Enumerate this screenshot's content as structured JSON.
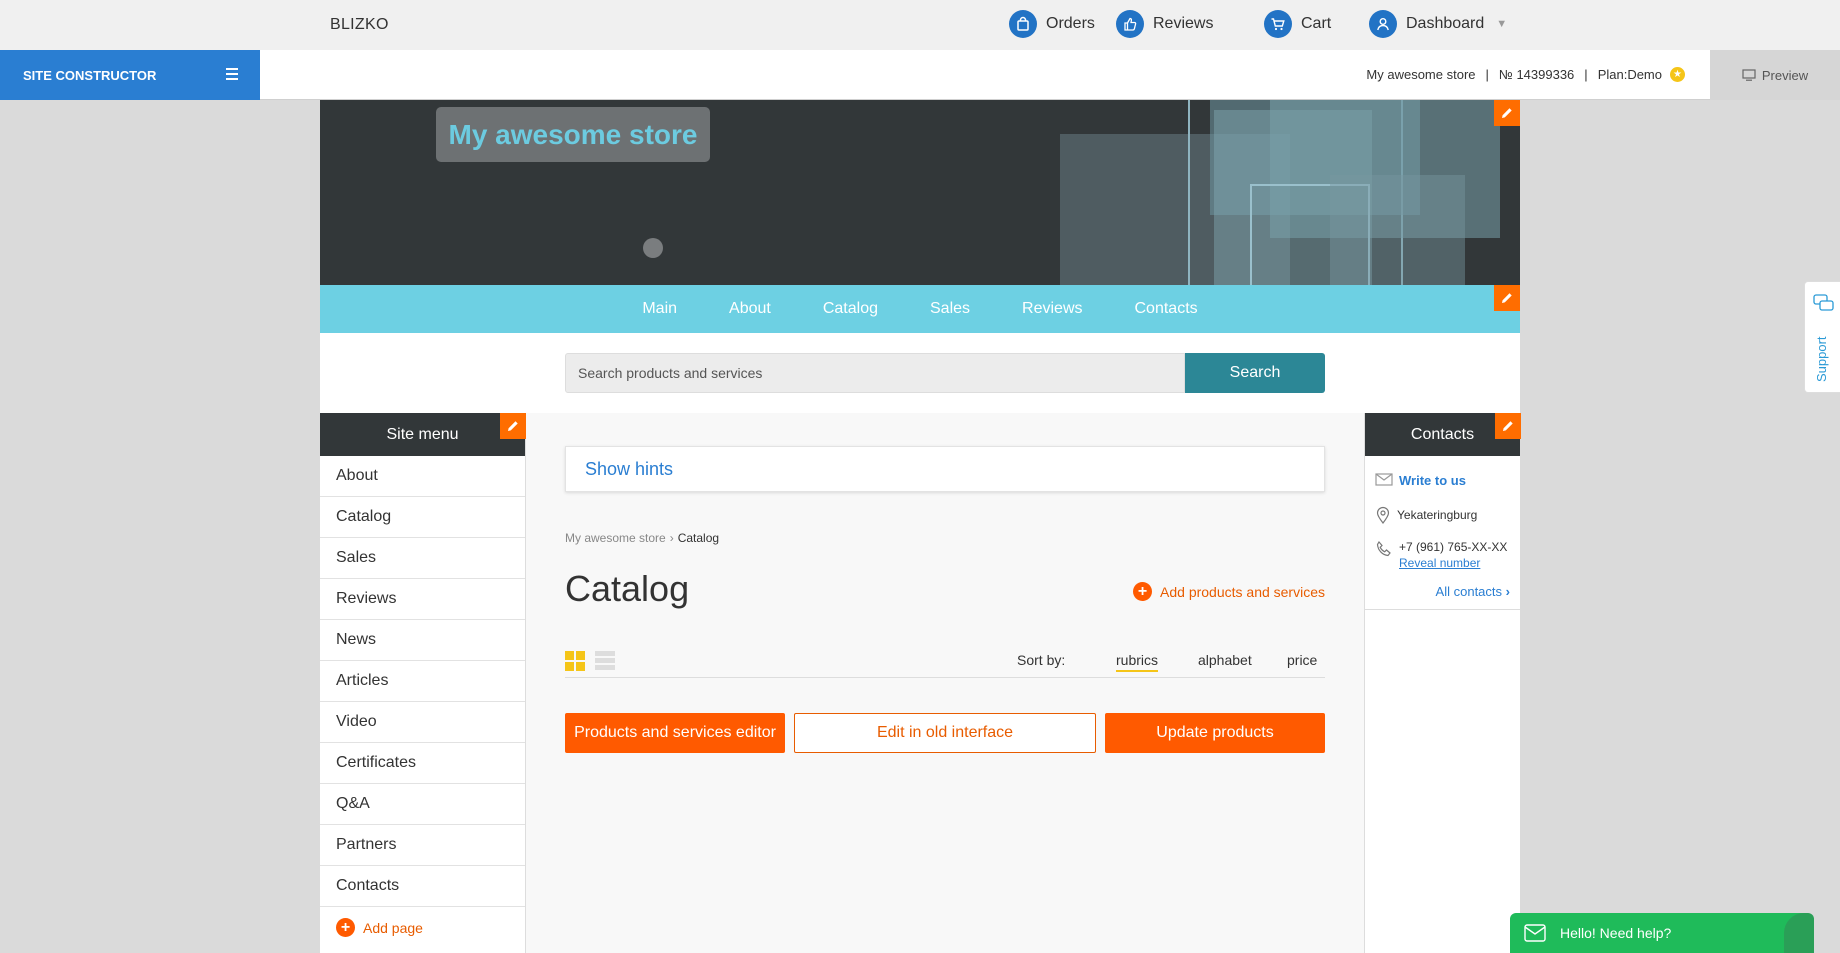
{
  "topbar": {
    "brand": "BLIZKO",
    "orders": "Orders",
    "reviews": "Reviews",
    "cart": "Cart",
    "dashboard": "Dashboard"
  },
  "constructor": {
    "title": "SITE CONSTRUCTOR",
    "store_name": "My awesome store",
    "store_number": "№ 14399336",
    "plan": "Plan:Demo",
    "preview": "Preview"
  },
  "site": {
    "logo_text": "My awesome store",
    "nav": [
      "Main",
      "About",
      "Catalog",
      "Sales",
      "Reviews",
      "Contacts"
    ],
    "search_placeholder": "Search products and services",
    "search_button": "Search"
  },
  "left_menu": {
    "title": "Site menu",
    "items": [
      "About",
      "Catalog",
      "Sales",
      "Reviews",
      "News",
      "Articles",
      "Video",
      "Certificates",
      "Q&A",
      "Partners",
      "Contacts"
    ],
    "add_page": "Add page"
  },
  "contacts": {
    "title": "Contacts",
    "write": "Write to us",
    "city": "Yekateringburg",
    "phone": "+7 (961) 765-XX-XX",
    "reveal": "Reveal number",
    "all": "All contacts"
  },
  "main": {
    "hints": "Show hints",
    "breadcrumb": [
      "My awesome store",
      "Catalog"
    ],
    "title": "Catalog",
    "add_products": "Add products and services",
    "sort_label": "Sort by:",
    "sort_options": [
      "rubrics",
      "alphabet",
      "price"
    ],
    "btn_editor": "Products and services editor",
    "btn_old": "Edit in old interface",
    "btn_update": "Update products"
  },
  "widgets": {
    "support": "Support",
    "chat": "Hello! Need help?"
  },
  "colors": {
    "accent_blue": "#2a7ed2",
    "nav_cyan": "#6dd0e3",
    "orange": "#ff5a00",
    "search_teal": "#2c8796",
    "chat_green": "#1fbb5a"
  }
}
